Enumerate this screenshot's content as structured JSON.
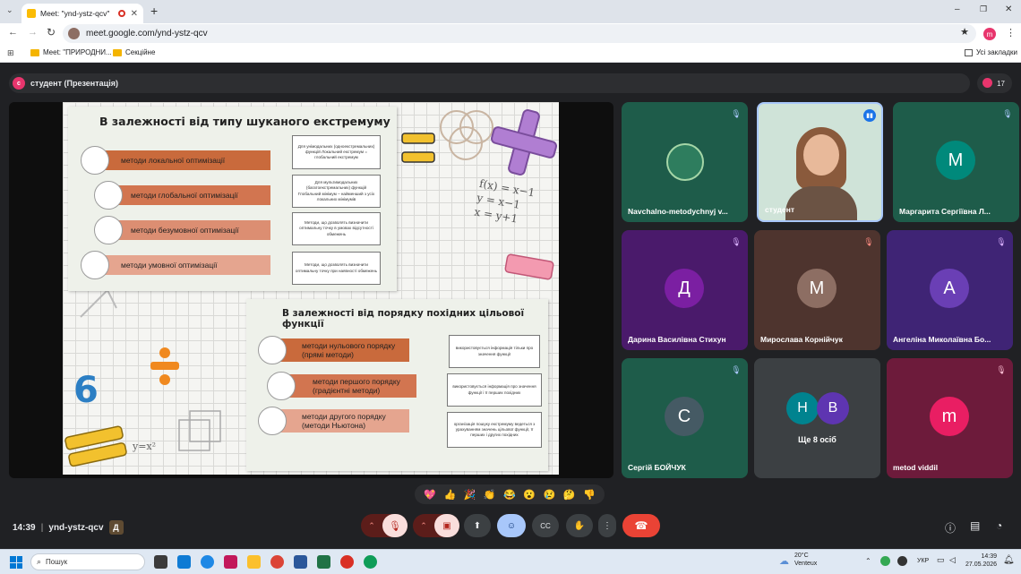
{
  "browser": {
    "tab_title": "Meet: \"ynd-ystz-qcv\"",
    "url": "meet.google.com/ynd-ystz-qcv",
    "bookmarks": [
      "Meet: \"ПРИРОДНИ...",
      "Секційне"
    ],
    "all_bookmarks": "Усі закладки",
    "profile_initial": "m"
  },
  "meet": {
    "presenter_label": "студент (Презентація)",
    "presenter_initial": "с",
    "people_count": "17",
    "time": "14:39",
    "meeting_code": "ynd-ystz-qcv",
    "self_initial": "Д"
  },
  "slide": {
    "title_top": "В залежності від типу шуканого екстремуму",
    "top_methods": [
      "методи локальної оптимізації",
      "методи глобальної оптимізації",
      "методи безумовної оптимізації",
      "методи умовної оптимізації"
    ],
    "top_notes": [
      "Для унімодальних (одноекстремальних) функцій Локальний екстремум = глобальний екстремум",
      "Для мультимодальних (багатоекстремальних) функцій Глобальний мінімум – найменший з усіх локальних мінімумів",
      "Методи, що дозволять визначити оптимальну точку в умовах відсутності обмежень",
      "Методи, що дозволять визначити оптимальну точку при наявності обмежень"
    ],
    "title_bottom": "В залежності від порядку похідних цільової функції",
    "bottom_methods": [
      "методи нульового порядку (прямі методи)",
      "методи першого порядку (градієнтні методи)",
      "методи другого порядку (методи Ньютона)"
    ],
    "bottom_notes": [
      "використовується інформація тільки про значення функції",
      "використовується інформація про значення функції і її перших похідних",
      "організація пошуку екстремуму ведеться з урахуванням значень цільової функції, її перших і других похідних"
    ],
    "formula_lines": [
      "f(x) = x−1",
      "y = x−1",
      "x = y+1"
    ],
    "formula_small": "y=x²"
  },
  "participants": [
    {
      "name": "Navchalno-metodychnyj v...",
      "initial": "",
      "color": "#1e5c4a",
      "muted": true
    },
    {
      "name": "студент",
      "initial": "",
      "color": "#cfe3d8",
      "muted": false,
      "speaking": true
    },
    {
      "name": "Маргарита Сергіївна Л...",
      "initial": "М",
      "color": "#00897b",
      "muted": true
    },
    {
      "name": "Дарина Василівна Стихун",
      "initial": "Д",
      "color": "#7b1fa2",
      "muted": true
    },
    {
      "name": "Мирослава Корнійчук",
      "initial": "М",
      "color": "#8d6e63",
      "muted": true
    },
    {
      "name": "Ангеліна Миколаївна Бо...",
      "initial": "А",
      "color": "#6a3fb5",
      "muted": true
    },
    {
      "name": "Сергій БОЙЧУК",
      "initial": "С",
      "color": "#455a64",
      "muted": true
    },
    {
      "name": "Ще 8 осіб",
      "initial": "",
      "color": "",
      "muted": false,
      "others": [
        "Н",
        "В"
      ]
    },
    {
      "name": "metod viddil",
      "initial": "m",
      "color": "#e91e63",
      "muted": true
    }
  ],
  "reactions": [
    "💖",
    "👍",
    "🎉",
    "👏",
    "😂",
    "😮",
    "😢",
    "🤔",
    "👎"
  ],
  "taskbar": {
    "search_placeholder": "Пошук",
    "weather_temp": "20°C",
    "weather_desc": "Venteux",
    "lang": "УКР",
    "clock_time": "14:39",
    "clock_date": "27.05.2026"
  },
  "colors": {
    "accent_red": "#ea4335",
    "meet_bg": "#202124",
    "speaking_border": "#a8c7fa"
  }
}
